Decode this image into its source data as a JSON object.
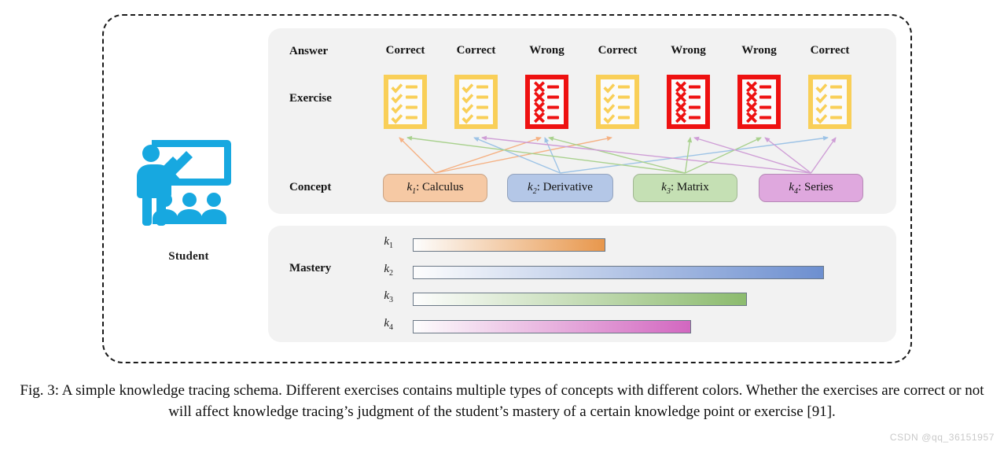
{
  "figure": {
    "caption": "Fig. 3: A simple knowledge tracing schema. Different exercises contains multiple types of concepts with different colors. Whether the exercises are correct or not will affect knowledge tracing’s judgment of the student’s mastery of a certain knowledge point or exercise [91].",
    "watermark": "CSDN @qq_36151957"
  },
  "student": {
    "label": "Student",
    "icon": "teacher-whiteboard-students-icon",
    "color": "#17a8e0"
  },
  "rows": {
    "answer": "Answer",
    "exercise": "Exercise",
    "concept": "Concept",
    "mastery": "Mastery"
  },
  "answers": [
    {
      "text": "Correct",
      "status": "correct"
    },
    {
      "text": "Correct",
      "status": "correct"
    },
    {
      "text": "Wrong",
      "status": "wrong"
    },
    {
      "text": "Correct",
      "status": "correct"
    },
    {
      "text": "Wrong",
      "status": "wrong"
    },
    {
      "text": "Wrong",
      "status": "wrong"
    },
    {
      "text": "Correct",
      "status": "correct"
    }
  ],
  "exercises": [
    {
      "name": "exercise-card-1",
      "status": "correct",
      "icon": "checklist-check-icon",
      "color": "#f9cf58"
    },
    {
      "name": "exercise-card-2",
      "status": "correct",
      "icon": "checklist-check-icon",
      "color": "#f9cf58"
    },
    {
      "name": "exercise-card-3",
      "status": "wrong",
      "icon": "checklist-cross-icon",
      "color": "#ee1111"
    },
    {
      "name": "exercise-card-4",
      "status": "correct",
      "icon": "checklist-check-icon",
      "color": "#f9cf58"
    },
    {
      "name": "exercise-card-5",
      "status": "wrong",
      "icon": "checklist-cross-icon",
      "color": "#ee1111"
    },
    {
      "name": "exercise-card-6",
      "status": "wrong",
      "icon": "checklist-cross-icon",
      "color": "#ee1111"
    },
    {
      "name": "exercise-card-7",
      "status": "correct",
      "icon": "checklist-check-icon",
      "color": "#f9cf58"
    }
  ],
  "concepts": [
    {
      "key": "k",
      "index": "1",
      "name": "Calculus",
      "label": "k₁: Calculus",
      "color": "#f6c9a4",
      "arrow_color": "#f5b183"
    },
    {
      "key": "k",
      "index": "2",
      "name": "Derivative",
      "label": "k₂: Derivative",
      "color": "#b4c7e7",
      "arrow_color": "#9dc3e6"
    },
    {
      "key": "k",
      "index": "3",
      "name": "Matrix",
      "label": "k₃: Matrix",
      "color": "#c5e0b4",
      "arrow_color": "#a9d18e"
    },
    {
      "key": "k",
      "index": "4",
      "name": "Series",
      "label": "k₄: Series",
      "color": "#dfa8de",
      "arrow_color": "#cf9ed6"
    }
  ],
  "chart_data": {
    "type": "bar",
    "title": "Mastery",
    "orientation": "horizontal",
    "categories": [
      "k1",
      "k2",
      "k3",
      "k4"
    ],
    "category_labels": [
      "k₁",
      "k₂",
      "k₃",
      "k₄"
    ],
    "values": [
      45,
      96,
      78,
      65
    ],
    "xlim": [
      0,
      100
    ],
    "xlabel": "",
    "ylabel": "",
    "grid": false,
    "legend": false,
    "bar_colors": [
      "#e8974c",
      "#6d8fd0",
      "#8cbb6e",
      "#d267c0"
    ],
    "gradient": "white-to-color-left-to-right"
  }
}
